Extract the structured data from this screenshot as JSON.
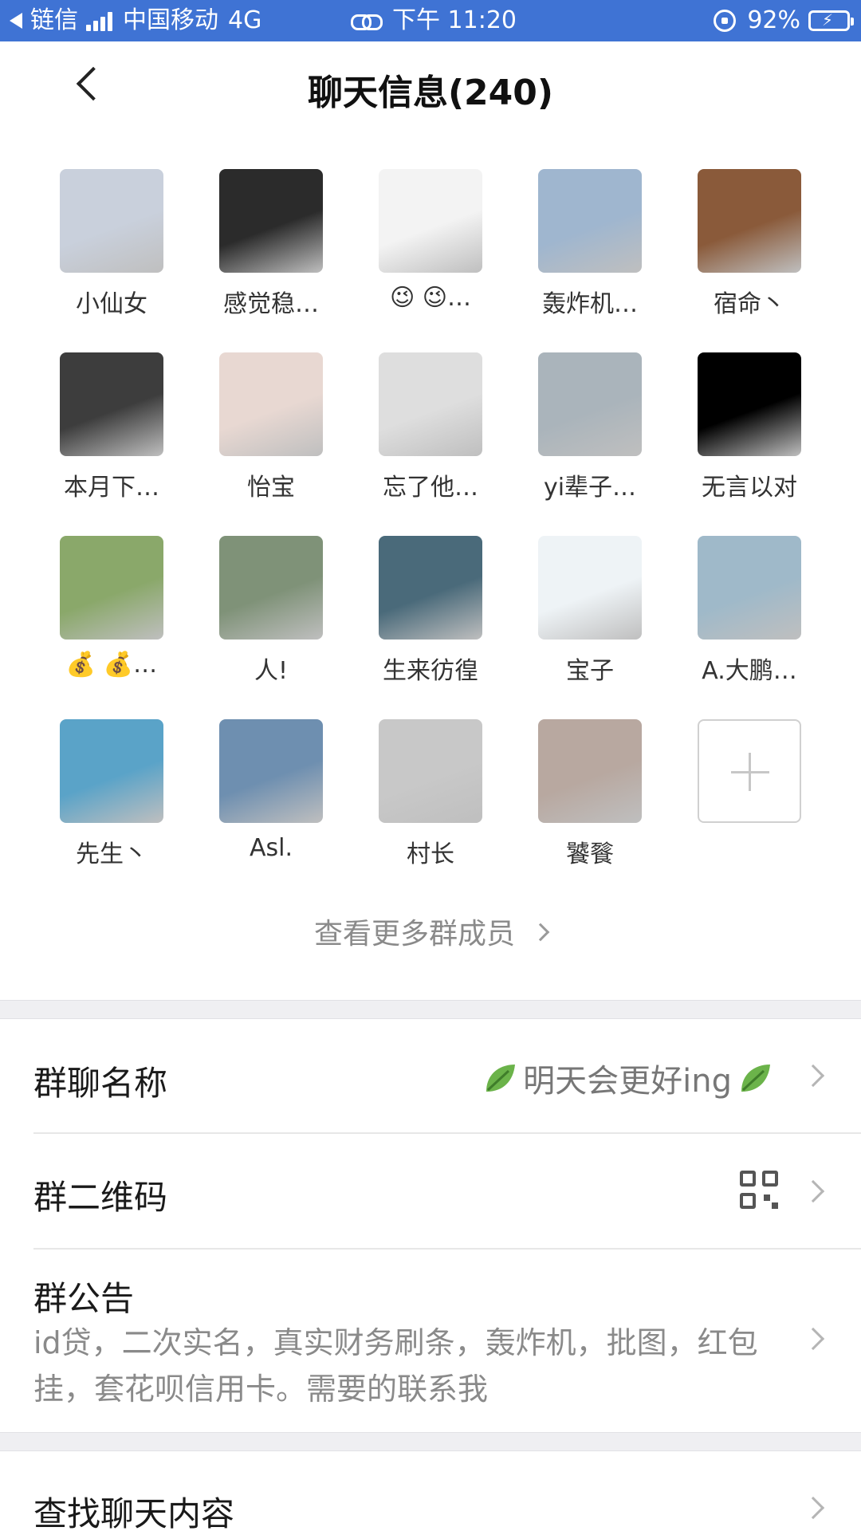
{
  "status_bar": {
    "back_app": "链信",
    "carrier": "中国移动",
    "network": "4G",
    "time": "下午 11:20",
    "battery": "92%"
  },
  "nav": {
    "title": "聊天信息(240)"
  },
  "members": [
    {
      "name": "小仙女",
      "avatar_color": "#c9d0dc"
    },
    {
      "name": "感觉稳…",
      "avatar_color": "#2b2b2b"
    },
    {
      "name": "😉 😉…",
      "avatar_color": "#f3f3f3"
    },
    {
      "name": "轰炸机…",
      "avatar_color": "#9fb6cf"
    },
    {
      "name": "宿命丶",
      "avatar_color": "#8a5a3a"
    },
    {
      "name": "本月下…",
      "avatar_color": "#3d3d3d"
    },
    {
      "name": "怡宝",
      "avatar_color": "#e8d8d2"
    },
    {
      "name": "忘了他…",
      "avatar_color": "#dedede"
    },
    {
      "name": "yi辈子…",
      "avatar_color": "#aab4bb"
    },
    {
      "name": "无言以对",
      "avatar_color": "#000000"
    },
    {
      "name": "💰 💰…",
      "avatar_color": "#8aa86a"
    },
    {
      "name": "人!",
      "avatar_color": "#7f9278"
    },
    {
      "name": "生来彷徨",
      "avatar_color": "#4a6a7a"
    },
    {
      "name": "宝子",
      "avatar_color": "#eef3f6"
    },
    {
      "name": "A.大鹏…",
      "avatar_color": "#9fb9c9"
    },
    {
      "name": "先生丶",
      "avatar_color": "#5aa3c8"
    },
    {
      "name": "Asl.",
      "avatar_color": "#6e8fb0"
    },
    {
      "name": "村长",
      "avatar_color": "#c8c8c8"
    },
    {
      "name": "饕餮",
      "avatar_color": "#b8a8a0"
    }
  ],
  "more_members": "查看更多群成员",
  "settings": {
    "group_name_label": "群聊名称",
    "group_name_value": "明天会更好ing",
    "qr_label": "群二维码",
    "notice_label": "群公告",
    "notice_text": "id贷，二次实名，真实财务刷条，轰炸机，批图，红包挂，套花呗信用卡。需要的联系我",
    "search_label": "查找聊天内容"
  },
  "colors": {
    "status_bar": "#3f73d4",
    "leaf": "#6bb34a"
  }
}
